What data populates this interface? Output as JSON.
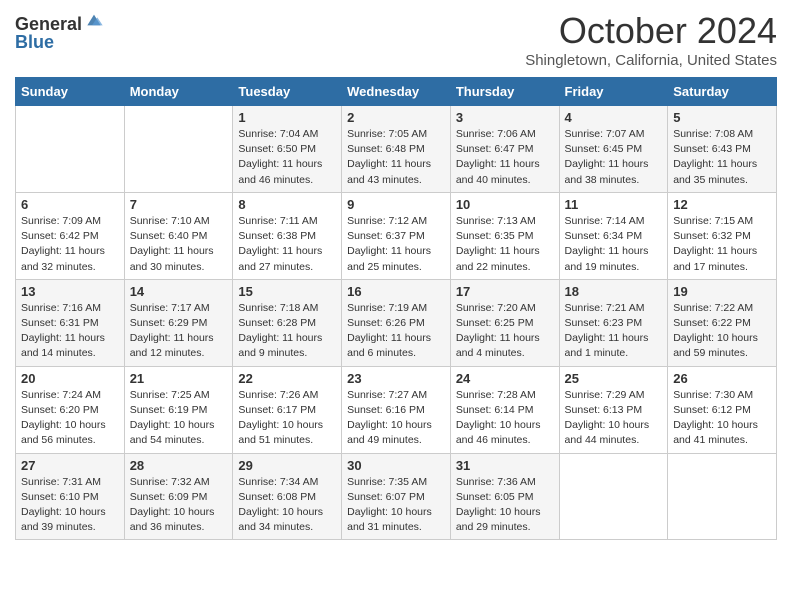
{
  "header": {
    "logo_general": "General",
    "logo_blue": "Blue",
    "title": "October 2024",
    "subtitle": "Shingletown, California, United States"
  },
  "days_of_week": [
    "Sunday",
    "Monday",
    "Tuesday",
    "Wednesday",
    "Thursday",
    "Friday",
    "Saturday"
  ],
  "weeks": [
    [
      {
        "day": "",
        "info": ""
      },
      {
        "day": "",
        "info": ""
      },
      {
        "day": "1",
        "info": "Sunrise: 7:04 AM\nSunset: 6:50 PM\nDaylight: 11 hours\nand 46 minutes."
      },
      {
        "day": "2",
        "info": "Sunrise: 7:05 AM\nSunset: 6:48 PM\nDaylight: 11 hours\nand 43 minutes."
      },
      {
        "day": "3",
        "info": "Sunrise: 7:06 AM\nSunset: 6:47 PM\nDaylight: 11 hours\nand 40 minutes."
      },
      {
        "day": "4",
        "info": "Sunrise: 7:07 AM\nSunset: 6:45 PM\nDaylight: 11 hours\nand 38 minutes."
      },
      {
        "day": "5",
        "info": "Sunrise: 7:08 AM\nSunset: 6:43 PM\nDaylight: 11 hours\nand 35 minutes."
      }
    ],
    [
      {
        "day": "6",
        "info": "Sunrise: 7:09 AM\nSunset: 6:42 PM\nDaylight: 11 hours\nand 32 minutes."
      },
      {
        "day": "7",
        "info": "Sunrise: 7:10 AM\nSunset: 6:40 PM\nDaylight: 11 hours\nand 30 minutes."
      },
      {
        "day": "8",
        "info": "Sunrise: 7:11 AM\nSunset: 6:38 PM\nDaylight: 11 hours\nand 27 minutes."
      },
      {
        "day": "9",
        "info": "Sunrise: 7:12 AM\nSunset: 6:37 PM\nDaylight: 11 hours\nand 25 minutes."
      },
      {
        "day": "10",
        "info": "Sunrise: 7:13 AM\nSunset: 6:35 PM\nDaylight: 11 hours\nand 22 minutes."
      },
      {
        "day": "11",
        "info": "Sunrise: 7:14 AM\nSunset: 6:34 PM\nDaylight: 11 hours\nand 19 minutes."
      },
      {
        "day": "12",
        "info": "Sunrise: 7:15 AM\nSunset: 6:32 PM\nDaylight: 11 hours\nand 17 minutes."
      }
    ],
    [
      {
        "day": "13",
        "info": "Sunrise: 7:16 AM\nSunset: 6:31 PM\nDaylight: 11 hours\nand 14 minutes."
      },
      {
        "day": "14",
        "info": "Sunrise: 7:17 AM\nSunset: 6:29 PM\nDaylight: 11 hours\nand 12 minutes."
      },
      {
        "day": "15",
        "info": "Sunrise: 7:18 AM\nSunset: 6:28 PM\nDaylight: 11 hours\nand 9 minutes."
      },
      {
        "day": "16",
        "info": "Sunrise: 7:19 AM\nSunset: 6:26 PM\nDaylight: 11 hours\nand 6 minutes."
      },
      {
        "day": "17",
        "info": "Sunrise: 7:20 AM\nSunset: 6:25 PM\nDaylight: 11 hours\nand 4 minutes."
      },
      {
        "day": "18",
        "info": "Sunrise: 7:21 AM\nSunset: 6:23 PM\nDaylight: 11 hours\nand 1 minute."
      },
      {
        "day": "19",
        "info": "Sunrise: 7:22 AM\nSunset: 6:22 PM\nDaylight: 10 hours\nand 59 minutes."
      }
    ],
    [
      {
        "day": "20",
        "info": "Sunrise: 7:24 AM\nSunset: 6:20 PM\nDaylight: 10 hours\nand 56 minutes."
      },
      {
        "day": "21",
        "info": "Sunrise: 7:25 AM\nSunset: 6:19 PM\nDaylight: 10 hours\nand 54 minutes."
      },
      {
        "day": "22",
        "info": "Sunrise: 7:26 AM\nSunset: 6:17 PM\nDaylight: 10 hours\nand 51 minutes."
      },
      {
        "day": "23",
        "info": "Sunrise: 7:27 AM\nSunset: 6:16 PM\nDaylight: 10 hours\nand 49 minutes."
      },
      {
        "day": "24",
        "info": "Sunrise: 7:28 AM\nSunset: 6:14 PM\nDaylight: 10 hours\nand 46 minutes."
      },
      {
        "day": "25",
        "info": "Sunrise: 7:29 AM\nSunset: 6:13 PM\nDaylight: 10 hours\nand 44 minutes."
      },
      {
        "day": "26",
        "info": "Sunrise: 7:30 AM\nSunset: 6:12 PM\nDaylight: 10 hours\nand 41 minutes."
      }
    ],
    [
      {
        "day": "27",
        "info": "Sunrise: 7:31 AM\nSunset: 6:10 PM\nDaylight: 10 hours\nand 39 minutes."
      },
      {
        "day": "28",
        "info": "Sunrise: 7:32 AM\nSunset: 6:09 PM\nDaylight: 10 hours\nand 36 minutes."
      },
      {
        "day": "29",
        "info": "Sunrise: 7:34 AM\nSunset: 6:08 PM\nDaylight: 10 hours\nand 34 minutes."
      },
      {
        "day": "30",
        "info": "Sunrise: 7:35 AM\nSunset: 6:07 PM\nDaylight: 10 hours\nand 31 minutes."
      },
      {
        "day": "31",
        "info": "Sunrise: 7:36 AM\nSunset: 6:05 PM\nDaylight: 10 hours\nand 29 minutes."
      },
      {
        "day": "",
        "info": ""
      },
      {
        "day": "",
        "info": ""
      }
    ]
  ]
}
